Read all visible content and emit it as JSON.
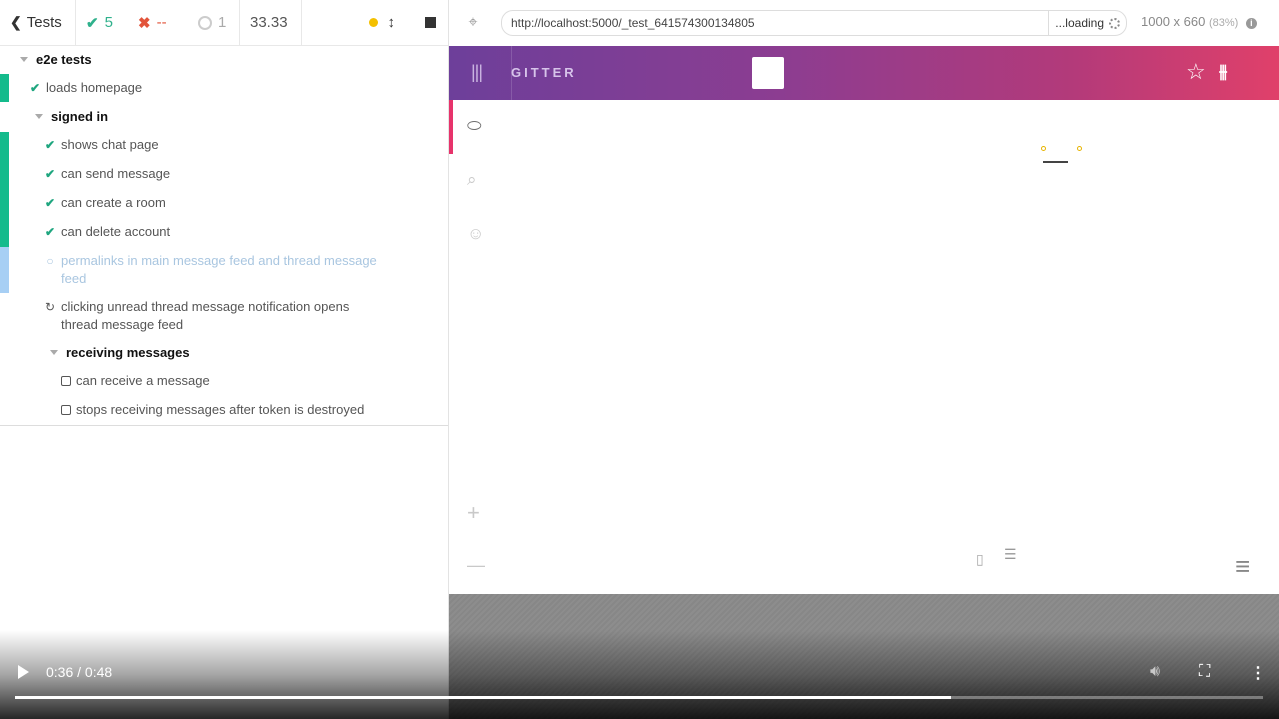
{
  "stats": {
    "back_label": "Tests",
    "passed": "5",
    "failed": "--",
    "pending": "1",
    "duration": "33.33"
  },
  "tree": {
    "root_suite": "e2e tests",
    "loads_homepage": "loads homepage",
    "signed_in": "signed in",
    "shows_chat_page": "shows chat page",
    "can_send_message": "can send message",
    "can_create_room": "can create a room",
    "can_delete_account": "can delete account",
    "permalinks_line1": "permalinks in main message feed and thread message",
    "permalinks_line2": "feed",
    "clicking_line1": "clicking unread thread message notification opens",
    "clicking_line2": "thread message feed",
    "receiving_messages": "receiving messages",
    "can_receive": "can receive a message",
    "stops_receiving": "stops receiving messages after token is destroyed"
  },
  "preview": {
    "url": "http://localhost:5000/_test_641574300134805",
    "loading": "...loading",
    "dimensions": "1000 x 660",
    "zoom": "(83%)"
  },
  "app": {
    "name": "GITTER"
  },
  "video": {
    "time": "0:36 / 0:48",
    "progress_fraction": 0.75
  },
  "colors": {
    "passed": "#2fb18c",
    "failed": "#e2543b",
    "accent": "#e7336b"
  }
}
